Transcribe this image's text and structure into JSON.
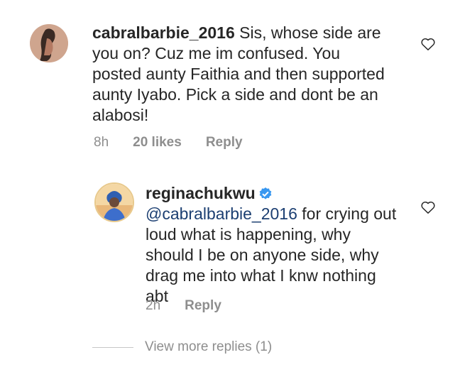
{
  "comments": [
    {
      "username": "cabralbarbie_2016",
      "text": " Sis, whose side are you on? Cuz me im confused. You posted aunty Faithia and then supported aunty Iyabo. Pick a side and dont be an alabosi!",
      "time": "8h",
      "likes": "20 likes",
      "reply": "Reply"
    },
    {
      "username": "reginachukwu",
      "mention": "@cabralbarbie_2016",
      "text": " for crying out loud what is happening, why should I be on anyone side, why drag me into what I knw nothing abt",
      "time": "2h",
      "reply": "Reply"
    }
  ],
  "view_more": "View more replies (1)",
  "icons": {
    "heart": "heart-icon",
    "verified": "verified-badge-icon"
  },
  "colors": {
    "mention": "#1c3f72",
    "verified": "#3897f0",
    "meta": "#8e8e8e"
  }
}
